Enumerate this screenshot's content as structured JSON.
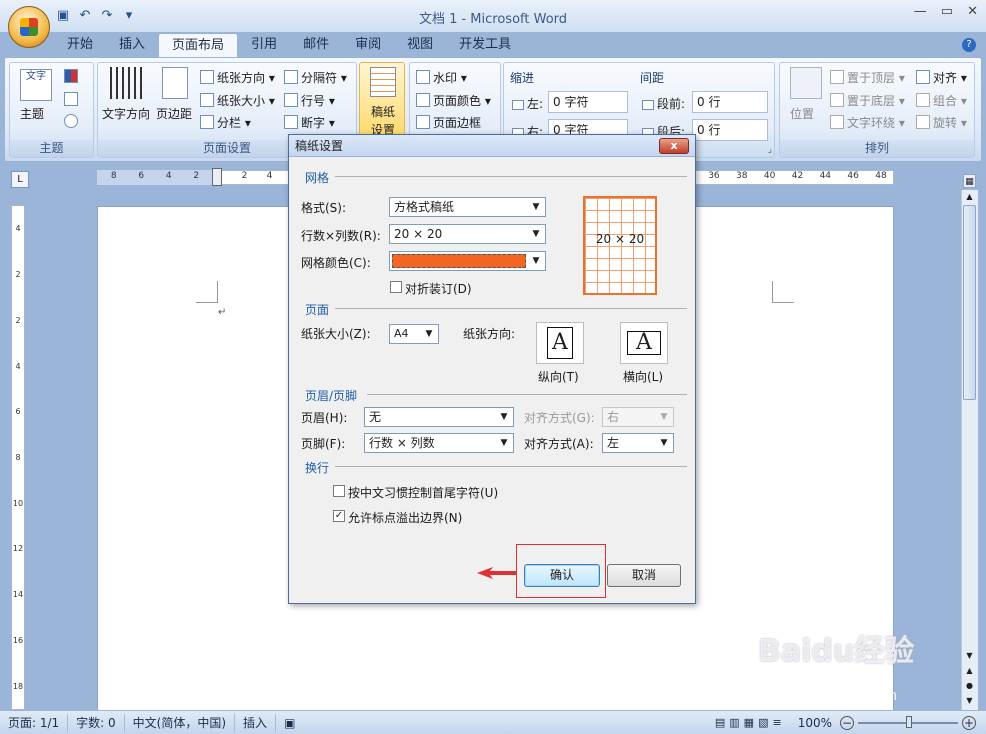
{
  "window": {
    "title": "文档 1 - Microsoft Word"
  },
  "tabs": [
    "开始",
    "插入",
    "页面布局",
    "引用",
    "邮件",
    "审阅",
    "视图",
    "开发工具"
  ],
  "active_tab": "页面布局",
  "ribbon": {
    "theme_group": {
      "label": "主题",
      "theme_button": "主题",
      "theme_icon_text": "文字"
    },
    "page_setup_group": {
      "label": "页面设置",
      "text_direction": "文字方向",
      "margins": "页边距",
      "orientation": "纸张方向",
      "size": "纸张大小",
      "columns": "分栏",
      "breaks": "分隔符",
      "line_numbers": "行号",
      "hyphenation": "断字"
    },
    "manuscript_group": {
      "label_line1": "稿纸",
      "label_line2": "设置"
    },
    "page_background_group": {
      "watermark": "水印",
      "page_color": "页面颜色",
      "page_borders": "页面边框"
    },
    "paragraph_group": {
      "indent_title": "缩进",
      "spacing_title": "间距",
      "left_label": "左:",
      "left_value": "0 字符",
      "right_label": "右:",
      "right_value": "0 字符",
      "before_label": "段前:",
      "before_value": "0 行",
      "after_label": "段后:",
      "after_value": "0 行"
    },
    "arrange_group": {
      "label": "排列",
      "position": "位置",
      "bring_front": "置于顶层",
      "send_back": "置于底层",
      "text_wrap": "文字环绕",
      "align": "对齐",
      "group": "组合",
      "rotate": "旋转"
    }
  },
  "ruler": {
    "h_ticks_left": [
      "8",
      "6",
      "4",
      "2"
    ],
    "h_ticks": [
      "2",
      "4"
    ],
    "h_ticks_right": [
      "36",
      "38",
      "40",
      "42",
      "44",
      "46",
      "48"
    ],
    "v_ticks": [
      "4",
      "2",
      "2",
      "4",
      "6",
      "8",
      "10",
      "12",
      "14",
      "16",
      "18"
    ],
    "corner": "L"
  },
  "document": {
    "para_mark": "↵"
  },
  "dialog": {
    "title": "稿纸设置",
    "close": "x",
    "grid_section": "网格",
    "style_label": "格式(S):",
    "style_value": "方格式稿纸",
    "rows_cols_label": "行数×列数(R):",
    "rows_cols_value": "20 × 20",
    "grid_color_label": "网格颜色(C):",
    "grid_color": "#f26522",
    "fold_binding_label": "对折装订(D)",
    "fold_binding_checked": false,
    "preview_text": "20 × 20",
    "page_section": "页面",
    "paper_size_label": "纸张大小(Z):",
    "paper_size_value": "A4",
    "orientation_label": "纸张方向:",
    "portrait_label": "纵向(T)",
    "landscape_label": "横向(L)",
    "orientation_glyph": "A",
    "header_footer_section": "页眉/页脚",
    "header_label": "页眉(H):",
    "header_value": "无",
    "header_align_label": "对齐方式(G):",
    "header_align_value": "右",
    "footer_label": "页脚(F):",
    "footer_value": "行数 × 列数",
    "footer_align_label": "对齐方式(A):",
    "footer_align_value": "左",
    "line_break_section": "换行",
    "chinese_rule_label": "按中文习惯控制首尾字符(U)",
    "chinese_rule_checked": false,
    "punct_overflow_label": "允许标点溢出边界(N)",
    "punct_overflow_checked": true,
    "ok_button": "确认",
    "cancel_button": "取消"
  },
  "statusbar": {
    "page": "页面: 1/1",
    "words": "字数: 0",
    "language": "中文(简体，中国)",
    "mode": "插入",
    "zoom": "100%"
  },
  "watermark": {
    "brand": "Baidu经验",
    "url": "jingyan.baidu.com"
  },
  "colors": {
    "accent": "#1f5ea6",
    "grid_orange": "#e8722e",
    "highlight_red": "#e03030"
  }
}
